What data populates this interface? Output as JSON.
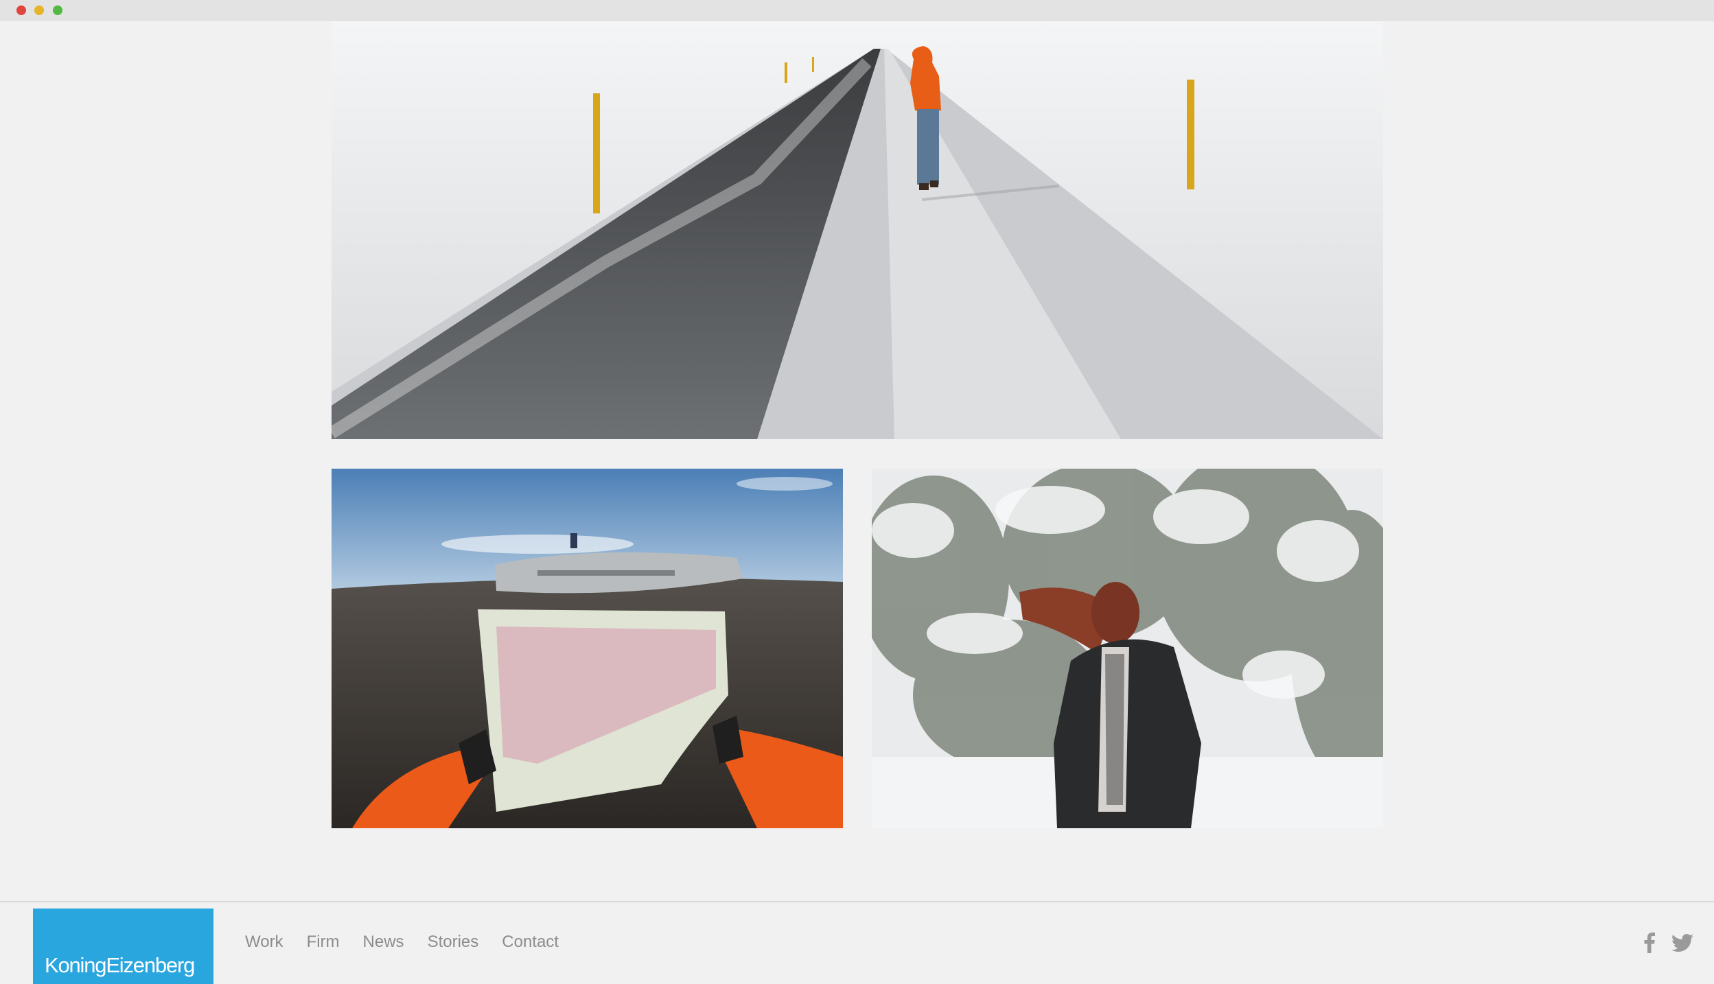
{
  "window": {
    "controls": [
      "close",
      "minimize",
      "maximize"
    ]
  },
  "gallery": {
    "photos": [
      {
        "name": "snowy-road-photo",
        "icon": "photo"
      },
      {
        "name": "plane-wreck-map-photo",
        "icon": "photo"
      },
      {
        "name": "woman-snow-forest-photo",
        "icon": "photo"
      }
    ]
  },
  "footer": {
    "logo_text": "KoningEizenberg",
    "logo_color": "#2aa6df",
    "nav": [
      {
        "label": "Work"
      },
      {
        "label": "Firm"
      },
      {
        "label": "News"
      },
      {
        "label": "Stories"
      },
      {
        "label": "Contact"
      }
    ],
    "social": [
      {
        "icon": "facebook-icon"
      },
      {
        "icon": "twitter-icon"
      }
    ]
  }
}
